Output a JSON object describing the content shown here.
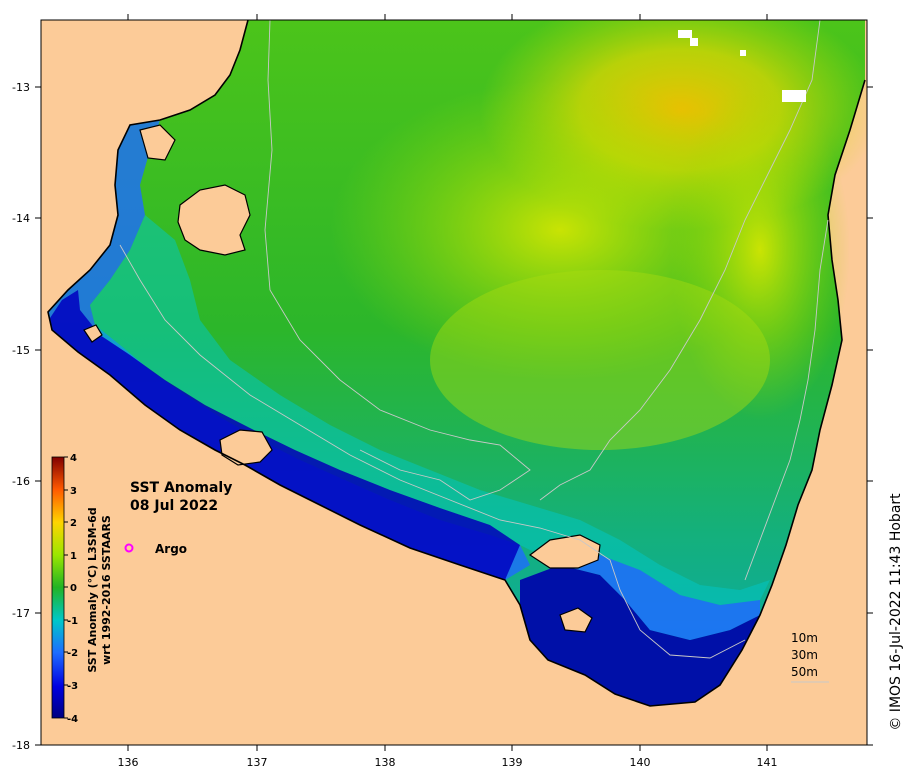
{
  "title_line1": "SST Anomaly",
  "title_line2": "08 Jul 2022",
  "legend": {
    "marker_label": "Argo",
    "marker_color": "#ff00ff"
  },
  "colorbar": {
    "title_line1": "SST Anomaly (°C) L3SM-6d",
    "title_line2": "wrt 1992-2016 SSTAARS",
    "ticks": [
      "4",
      "3",
      "2",
      "1",
      "0",
      "-1",
      "-2",
      "-3",
      "-4"
    ]
  },
  "depth_labels": [
    "10m",
    "30m",
    "50m"
  ],
  "credit": "© IMOS 16-Jul-2022 11:43 Hobart",
  "axes": {
    "x_ticks": [
      "136",
      "137",
      "138",
      "139",
      "140",
      "141"
    ],
    "y_ticks": [
      "-13",
      "-14",
      "-15",
      "-16",
      "-17",
      "-18"
    ]
  },
  "colors": {
    "land": "#fccb98",
    "coast": "#000000",
    "isobath": "#bfbfbf",
    "anomaly_cold": "#000080",
    "anomaly_zero": "#22b324",
    "anomaly_warm": "#800000"
  }
}
